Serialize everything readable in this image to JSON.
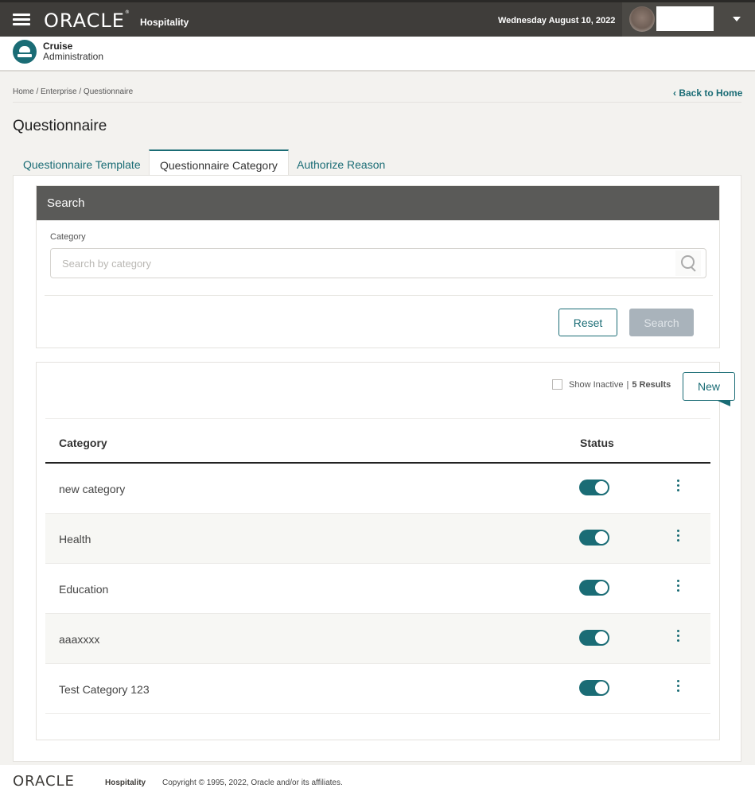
{
  "header": {
    "brand": "ORACLE",
    "brand_sub": "Hospitality",
    "date": "Wednesday August 10, 2022",
    "username": ""
  },
  "app": {
    "name": "Cruise",
    "module": "Administration"
  },
  "breadcrumb": "Home / Enterprise / Questionnaire",
  "back_link": "Back to Home",
  "page_title": "Questionnaire",
  "tabs": [
    {
      "label": "Questionnaire Template",
      "active": false
    },
    {
      "label": "Questionnaire Category",
      "active": true
    },
    {
      "label": "Authorize Reason",
      "active": false
    }
  ],
  "search": {
    "title": "Search",
    "field_label": "Category",
    "placeholder": "Search by category",
    "value": "",
    "reset_label": "Reset",
    "search_label": "Search"
  },
  "results": {
    "show_inactive_label": "Show Inactive",
    "show_inactive_checked": false,
    "separator": "|",
    "count_label": "5 Results",
    "new_label": "New",
    "columns": {
      "category": "Category",
      "status": "Status"
    },
    "rows": [
      {
        "category": "new category",
        "active": true
      },
      {
        "category": "Health",
        "active": true
      },
      {
        "category": "Education",
        "active": true
      },
      {
        "category": "aaaxxxx",
        "active": true
      },
      {
        "category": "Test Category 123",
        "active": true
      }
    ]
  },
  "footer": {
    "brand": "ORACLE",
    "brand_sub": "Hospitality",
    "copyright": "Copyright © 1995, 2022, Oracle and/or its affiliates."
  },
  "colors": {
    "accent": "#1a6c75",
    "topbar": "#3f3d3a",
    "search_header": "#5a5a58"
  }
}
